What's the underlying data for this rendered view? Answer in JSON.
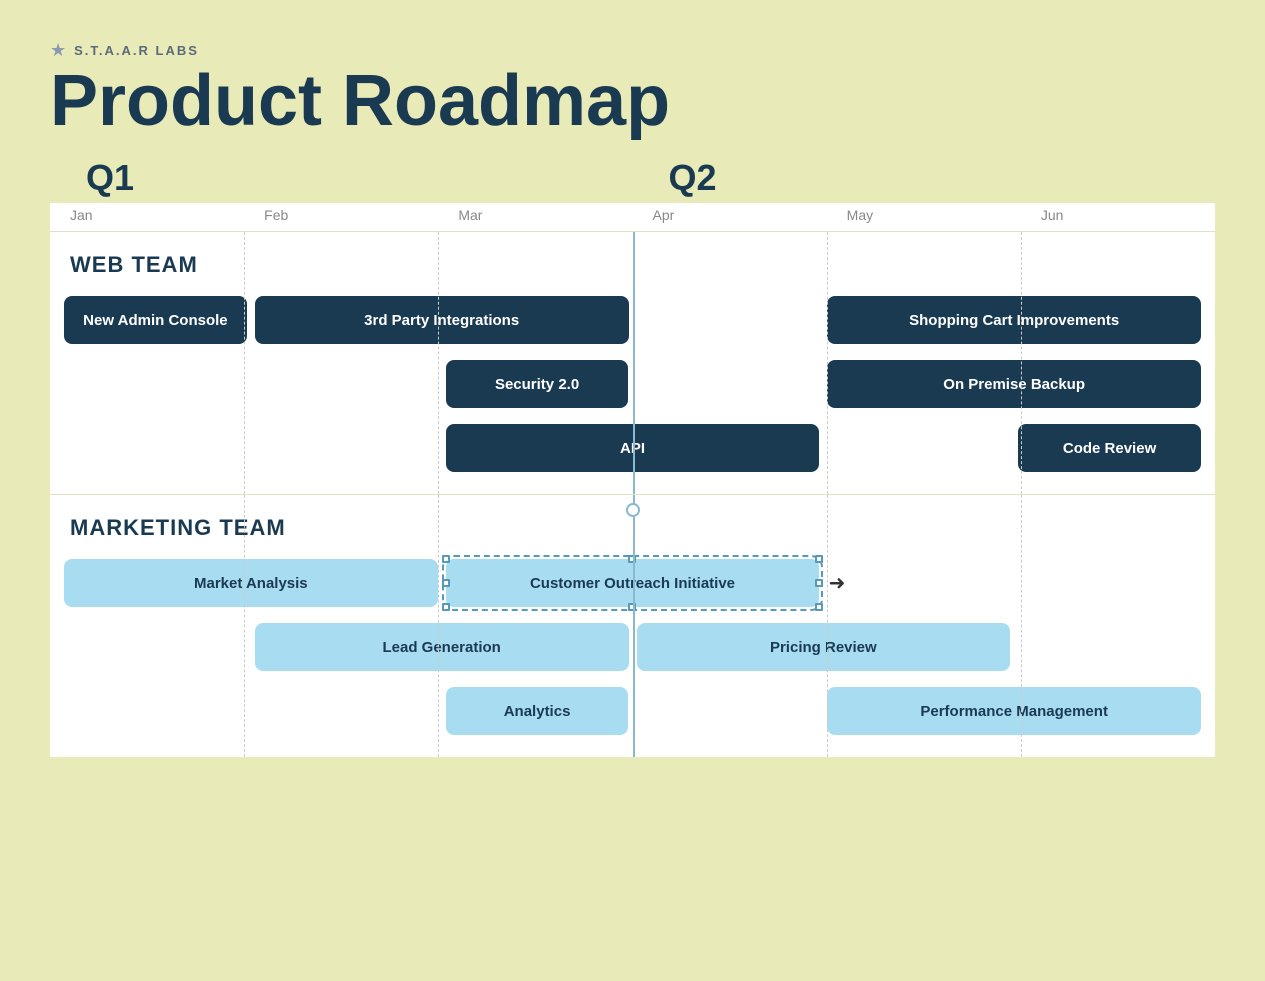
{
  "brand": {
    "name": "S.T.A.A.R LABS",
    "star": "★"
  },
  "page_title": "Product Roadmap",
  "quarters": [
    {
      "label": "Q1",
      "cols": [
        "Jan",
        "Feb",
        "Mar"
      ]
    },
    {
      "label": "Q2",
      "cols": [
        "Apr",
        "May",
        "Jun"
      ]
    }
  ],
  "colors": {
    "dark_task": "#1a3a52",
    "light_task": "#a8dcf0",
    "bg": "#e8ebb8",
    "text_light": "white",
    "text_dark": "#1a3a52"
  },
  "web_team": {
    "label": "WEB TEAM",
    "rows": [
      {
        "tasks": [
          {
            "label": "New Admin Console",
            "col_start": 1,
            "col_span": 1,
            "style": "dark"
          },
          {
            "label": "3rd Party Integrations",
            "col_start": 2,
            "col_span": 2,
            "style": "dark"
          },
          {
            "label": "Shopping Cart Improvements",
            "col_start": 5,
            "col_span": 2,
            "style": "dark"
          }
        ]
      },
      {
        "tasks": [
          {
            "label": "Security 2.0",
            "col_start": 3,
            "col_span": 1,
            "style": "dark"
          },
          {
            "label": "On Premise Backup",
            "col_start": 5,
            "col_span": 2,
            "style": "dark"
          }
        ]
      },
      {
        "tasks": [
          {
            "label": "API",
            "col_start": 3,
            "col_span": 2,
            "style": "dark"
          },
          {
            "label": "Code Review",
            "col_start": 6,
            "col_span": 1,
            "style": "dark"
          }
        ]
      }
    ]
  },
  "marketing_team": {
    "label": "MARKETING TEAM",
    "rows": [
      {
        "tasks": [
          {
            "label": "Market Analysis",
            "col_start": 1,
            "col_span": 2,
            "style": "light"
          },
          {
            "label": "Customer Outreach Initiative",
            "col_start": 3,
            "col_span": 2,
            "style": "selected"
          }
        ]
      },
      {
        "tasks": [
          {
            "label": "Lead Generation",
            "col_start": 2,
            "col_span": 2,
            "style": "light"
          },
          {
            "label": "Pricing Review",
            "col_start": 4,
            "col_span": 2,
            "style": "light"
          }
        ]
      },
      {
        "tasks": [
          {
            "label": "Analytics",
            "col_start": 3,
            "col_span": 1,
            "style": "light"
          },
          {
            "label": "Performance Management",
            "col_start": 5,
            "col_span": 2,
            "style": "light"
          }
        ]
      }
    ]
  }
}
